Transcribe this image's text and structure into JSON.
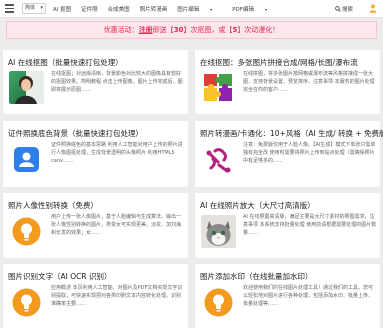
{
  "topbar": {
    "select_value": "简体",
    "nav": [
      "AI 抠图",
      "证件照",
      "合成美图",
      "照片转漫画",
      "图片编辑",
      "PDF编辑"
    ],
    "search_label": "搜索"
  },
  "banner": {
    "prefix": "优惠活动：",
    "register": "注册",
    "mid1": "即送【",
    "num1": "30",
    "mid2": "】次抠图，或【",
    "num2": "5",
    "suffix": "】次动漫化！"
  },
  "cards": [
    {
      "title": "AI 在线抠图（批量快速打包处理）",
      "desc": "在线抠图；对远缘清晰，背景颜色对比较大的图像具有较好的抠图效果。简明教程 点击上传图像，图片上传完成后，图即将展示原图……"
    },
    {
      "title": "在线抠图：多张图片拼接合成/网格/长图/瀑布流",
      "desc": "在线拼图，将多张图片按网格或瀑布流等风格拼接成一张大图，支持背景设置、预览排序、注意事项 本服务的图片处理完全在你的客户……"
    },
    {
      "title": "证件照换底色背景（批量快速打包处理）",
      "desc": "证件照换底色的基本思路 利用人工智能对用户上传的照片进行人像图抠处理，生成背景透明的头像照片 利用HTML5 canv……"
    },
    {
      "title": "照片转漫画/卡通化：10+风格（AI 生成/ 转换 + 免费版）",
      "desc": "注意：免费版仅用于人脸人像。【AI生成】模式下单张只需单独有完全改 使用时需要将照片上传到站点处理（需确保照片中有足够多的……"
    },
    {
      "title": "照片人像性别转换（免费）",
      "desc": "用户上传一张人像图片，基于人脸编辑与生成算法，输出一张人像性别转换的图片，男变女可实现更美、淡妆、加刘海和长发的效果；女……"
    },
    {
      "title": "AI 在线照片放大（大尺寸高清版）",
      "desc": "AI 在线照图高清版，满足主要是大尺寸素材的照图需求，注意事项 本系统支持批量处理 使用前请根据需要处理的图片数量……"
    },
    {
      "title": "图片识别文字（AI OCR 识别）",
      "desc": "应用概述 本页利用人工智能，对图片及PDF文档实现文字识别提取，可快速实现把对各类印刷文本内容转化处理，识别准确率主要……"
    },
    {
      "title": "图片添加水印（在线批量加水印）",
      "desc": "欢迎使用我们的在线图片处理工具！通过我们的工具，您可以轻松地对图片进行各种处理，包括添加水印、批量上传、批量处理等……"
    }
  ],
  "colors": {
    "accent": "#e02a50",
    "link": "#1e88e5",
    "banner_bg": "#fde7ec"
  }
}
